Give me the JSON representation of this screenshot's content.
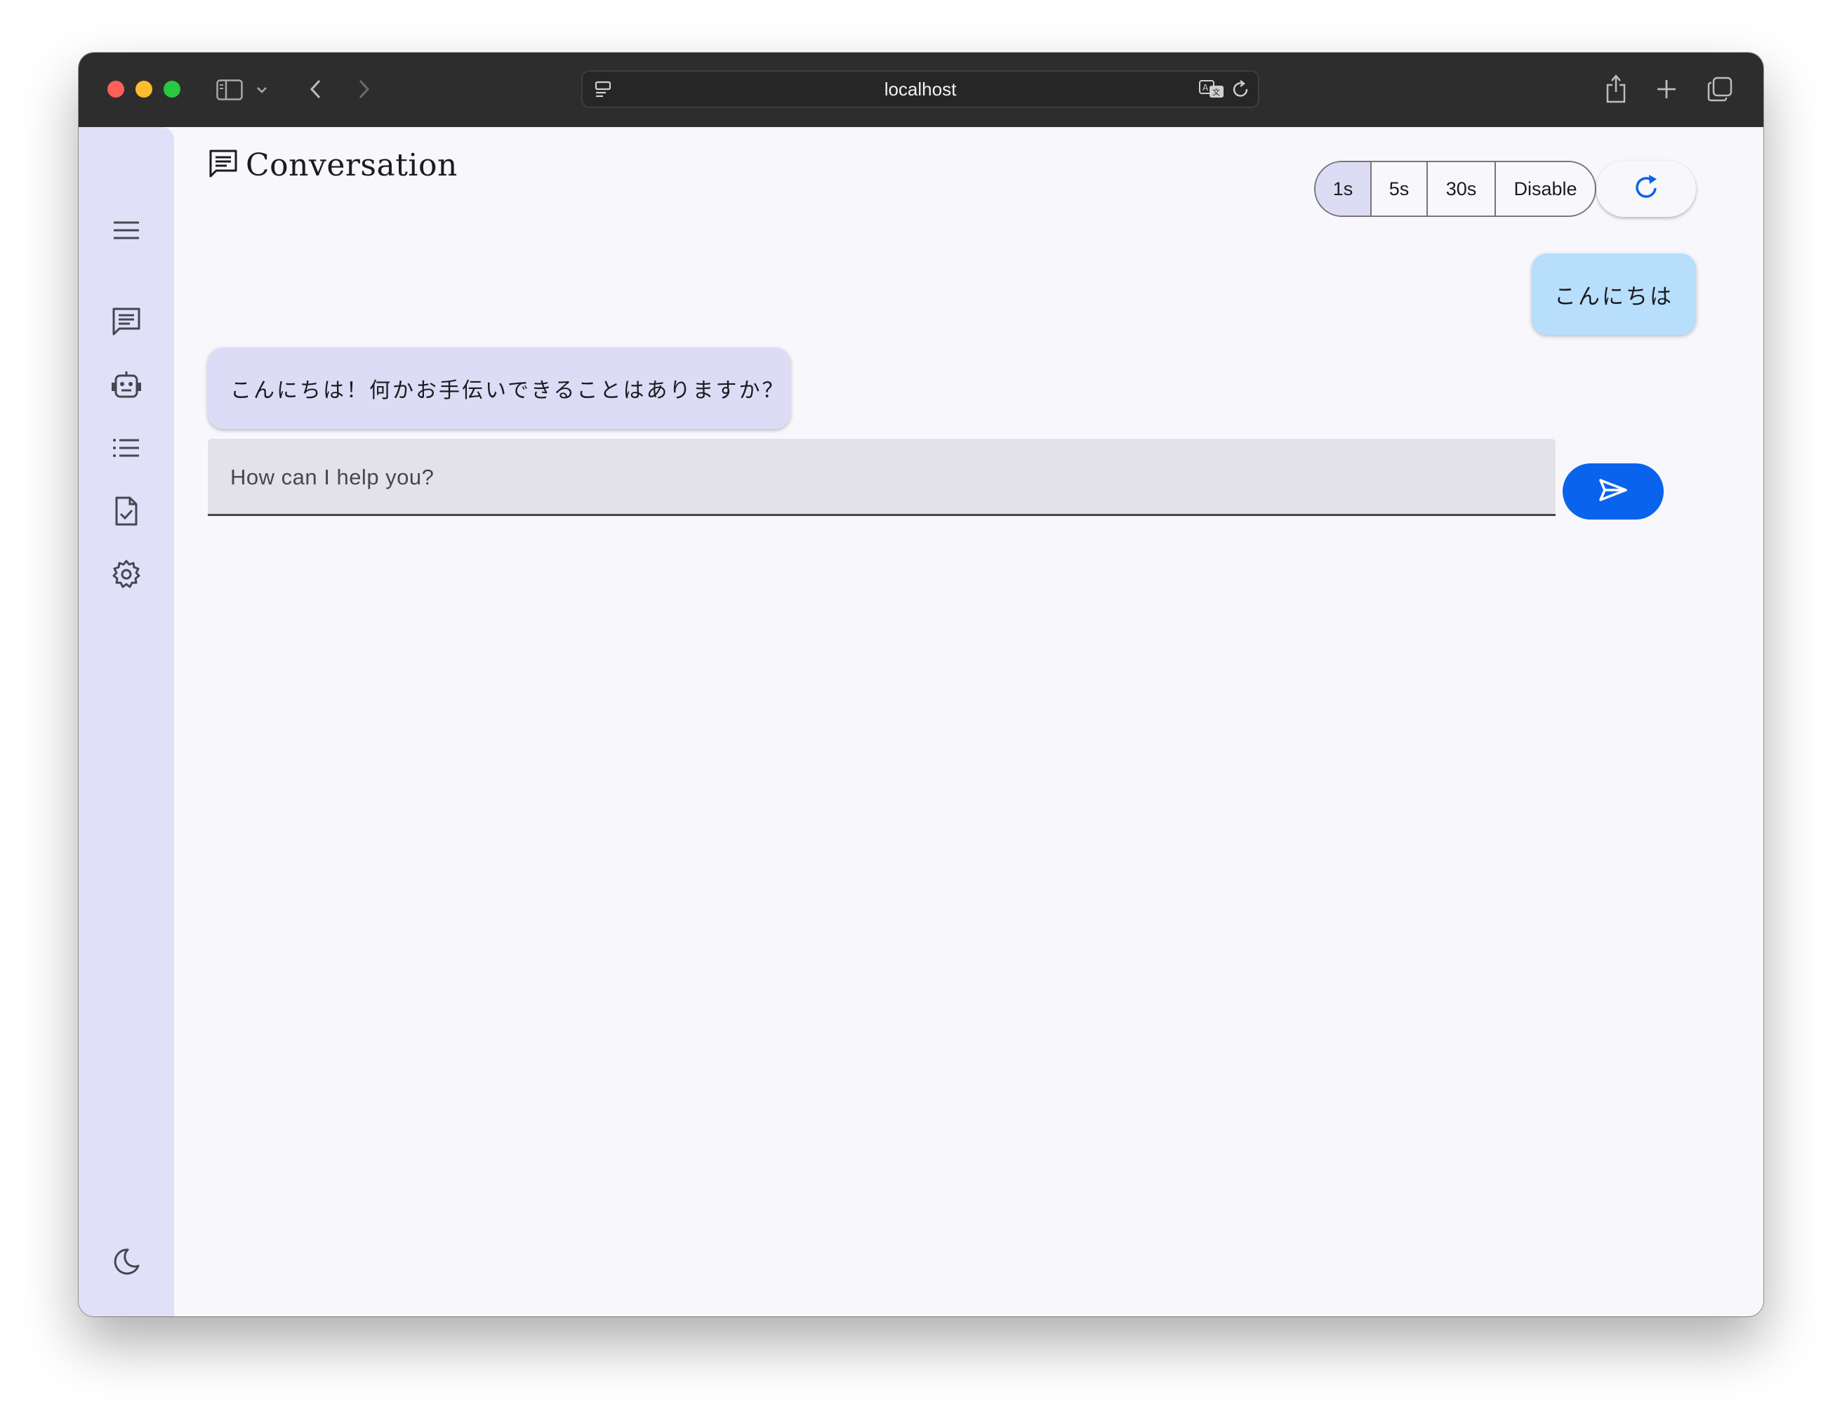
{
  "browser": {
    "address": "localhost",
    "icons": [
      "sidebar-toggle-icon",
      "chevron-down-icon",
      "back-icon",
      "forward-icon",
      "site-settings-icon",
      "translate-icon",
      "reload-icon",
      "share-icon",
      "new-tab-icon",
      "tab-overview-icon"
    ]
  },
  "sidebar": {
    "items": [
      "menu-icon",
      "chat-icon",
      "robot-icon",
      "list-icon",
      "document-check-icon",
      "settings-icon"
    ],
    "footer": "dark-mode-icon"
  },
  "header": {
    "title": "Conversation",
    "refresh_options": [
      "1s",
      "5s",
      "30s",
      "Disable"
    ],
    "selected_option": "1s"
  },
  "messages": [
    {
      "role": "user",
      "text": "こんにちは"
    },
    {
      "role": "assistant",
      "text": "こんにちは！何かお手伝いできることはありますか？"
    }
  ],
  "composer": {
    "placeholder": "How can I help you?",
    "value": ""
  },
  "colors": {
    "accent": "#0a63ec",
    "sidebar_bg": "#e0e0f8",
    "user_bubble": "#b7dffc",
    "assistant_bubble": "#dcdcf7"
  }
}
